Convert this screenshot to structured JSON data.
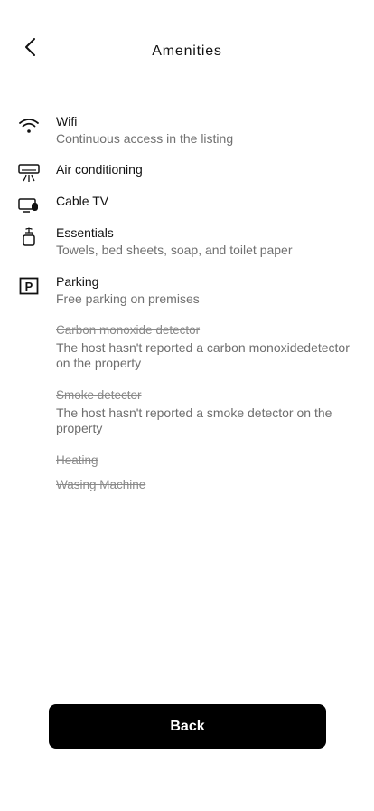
{
  "header": {
    "title": "Amenities"
  },
  "amenities": [
    {
      "icon": "wifi-icon",
      "label": "Wifi",
      "desc": "Continuous access in the listing",
      "available": true
    },
    {
      "icon": "air-conditioning-icon",
      "label": "Air conditioning",
      "desc": "",
      "available": true
    },
    {
      "icon": "tv-icon",
      "label": "Cable TV",
      "desc": "",
      "available": true
    },
    {
      "icon": "soap-icon",
      "label": "Essentials",
      "desc": "Towels, bed sheets, soap, and toilet paper",
      "available": true
    },
    {
      "icon": "parking-icon",
      "label": "Parking",
      "desc": "Free parking on premises",
      "available": true
    },
    {
      "icon": "",
      "label": "Carbon monoxide detector",
      "desc": "The host hasn't reported a carbon monoxidedetector on the property",
      "available": false
    },
    {
      "icon": "",
      "label": "Smoke detector",
      "desc": "The host hasn't reported a smoke detector on the property",
      "available": false
    },
    {
      "icon": "",
      "label": "Heating",
      "desc": "",
      "available": false
    },
    {
      "icon": "",
      "label": "Wasing Machine",
      "desc": "",
      "available": false
    }
  ],
  "footer": {
    "back_label": "Back"
  }
}
